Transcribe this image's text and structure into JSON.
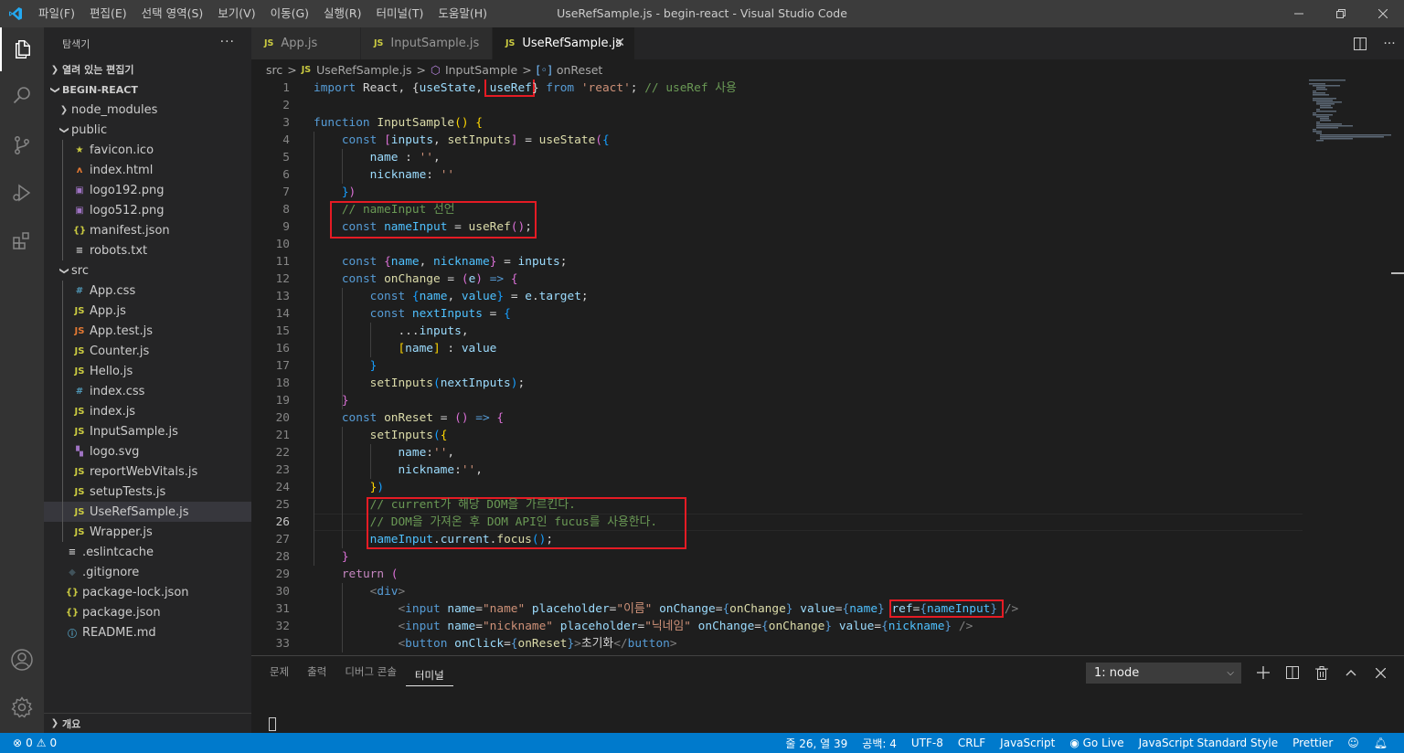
{
  "window": {
    "title": "UseRefSample.js - begin-react - Visual Studio Code",
    "menu": [
      "파일(F)",
      "편집(E)",
      "선택 영역(S)",
      "보기(V)",
      "이동(G)",
      "실행(R)",
      "터미널(T)",
      "도움말(H)"
    ]
  },
  "sidebar": {
    "title": "탐색기",
    "open_editors": "열려 있는 편집기",
    "project": "BEGIN-REACT",
    "outline": "개요",
    "tree": [
      {
        "label": "node_modules",
        "kind": "folder-closed",
        "depth": 0,
        "icon": ""
      },
      {
        "label": "public",
        "kind": "folder-open",
        "depth": 0,
        "icon": ""
      },
      {
        "label": "favicon.ico",
        "kind": "file",
        "depth": 1,
        "icon": "★",
        "color": "#cbcb41"
      },
      {
        "label": "index.html",
        "kind": "file",
        "depth": 1,
        "icon": "ʌ",
        "color": "#e37933"
      },
      {
        "label": "logo192.png",
        "kind": "file",
        "depth": 1,
        "icon": "▣",
        "color": "#a074c4"
      },
      {
        "label": "logo512.png",
        "kind": "file",
        "depth": 1,
        "icon": "▣",
        "color": "#a074c4"
      },
      {
        "label": "manifest.json",
        "kind": "file",
        "depth": 1,
        "icon": "{}",
        "color": "#cbcb41"
      },
      {
        "label": "robots.txt",
        "kind": "file",
        "depth": 1,
        "icon": "≡",
        "color": "#cccccc"
      },
      {
        "label": "src",
        "kind": "folder-open",
        "depth": 0,
        "icon": ""
      },
      {
        "label": "App.css",
        "kind": "file",
        "depth": 1,
        "icon": "#",
        "color": "#519aba"
      },
      {
        "label": "App.js",
        "kind": "file",
        "depth": 1,
        "icon": "JS",
        "color": "#cbcb41"
      },
      {
        "label": "App.test.js",
        "kind": "file",
        "depth": 1,
        "icon": "JS",
        "color": "#e37933"
      },
      {
        "label": "Counter.js",
        "kind": "file",
        "depth": 1,
        "icon": "JS",
        "color": "#cbcb41"
      },
      {
        "label": "Hello.js",
        "kind": "file",
        "depth": 1,
        "icon": "JS",
        "color": "#cbcb41"
      },
      {
        "label": "index.css",
        "kind": "file",
        "depth": 1,
        "icon": "#",
        "color": "#519aba"
      },
      {
        "label": "index.js",
        "kind": "file",
        "depth": 1,
        "icon": "JS",
        "color": "#cbcb41"
      },
      {
        "label": "InputSample.js",
        "kind": "file",
        "depth": 1,
        "icon": "JS",
        "color": "#cbcb41"
      },
      {
        "label": "logo.svg",
        "kind": "file",
        "depth": 1,
        "icon": "▚",
        "color": "#a074c4"
      },
      {
        "label": "reportWebVitals.js",
        "kind": "file",
        "depth": 1,
        "icon": "JS",
        "color": "#cbcb41"
      },
      {
        "label": "setupTests.js",
        "kind": "file",
        "depth": 1,
        "icon": "JS",
        "color": "#cbcb41"
      },
      {
        "label": "UseRefSample.js",
        "kind": "file",
        "depth": 1,
        "icon": "JS",
        "color": "#cbcb41",
        "selected": true
      },
      {
        "label": "Wrapper.js",
        "kind": "file",
        "depth": 1,
        "icon": "JS",
        "color": "#cbcb41"
      },
      {
        "label": ".eslintcache",
        "kind": "file",
        "depth": 0,
        "icon": "≡",
        "color": "#cccccc"
      },
      {
        "label": ".gitignore",
        "kind": "file",
        "depth": 0,
        "icon": "◆",
        "color": "#41535b"
      },
      {
        "label": "package-lock.json",
        "kind": "file",
        "depth": 0,
        "icon": "{}",
        "color": "#cbcb41"
      },
      {
        "label": "package.json",
        "kind": "file",
        "depth": 0,
        "icon": "{}",
        "color": "#cbcb41"
      },
      {
        "label": "README.md",
        "kind": "file",
        "depth": 0,
        "icon": "ⓘ",
        "color": "#519aba"
      }
    ]
  },
  "tabs": [
    {
      "label": "App.js",
      "active": false
    },
    {
      "label": "InputSample.js",
      "active": false
    },
    {
      "label": "UseRefSample.js",
      "active": true
    }
  ],
  "breadcrumb": {
    "folder": "src",
    "file": "UseRefSample.js",
    "function": "InputSample",
    "member": "onReset"
  },
  "editor": {
    "current_line": 26,
    "lines": [
      [
        [
          "kw",
          "import"
        ],
        [
          "t",
          " React, {"
        ],
        [
          "var",
          "useState"
        ],
        [
          "t",
          ", "
        ],
        [
          "var",
          "useRef"
        ],
        [
          "t",
          "} "
        ],
        [
          "kw",
          "from"
        ],
        [
          "t",
          " "
        ],
        [
          "str",
          "'react'"
        ],
        [
          "t",
          "; "
        ],
        [
          "cmt",
          "// useRef 사용"
        ]
      ],
      [],
      [
        [
          "kw",
          "function"
        ],
        [
          "t",
          " "
        ],
        [
          "fnc",
          "InputSample"
        ],
        [
          "p1",
          "()"
        ],
        [
          "t",
          " "
        ],
        [
          "p1",
          "{"
        ]
      ],
      [
        [
          "t",
          "    "
        ],
        [
          "kw",
          "const"
        ],
        [
          "t",
          " "
        ],
        [
          "p2",
          "["
        ],
        [
          "var",
          "inputs"
        ],
        [
          "t",
          ", "
        ],
        [
          "fnc",
          "setInputs"
        ],
        [
          "p2",
          "]"
        ],
        [
          "t",
          " = "
        ],
        [
          "fnc",
          "useState"
        ],
        [
          "p2",
          "("
        ],
        [
          "p3",
          "{"
        ]
      ],
      [
        [
          "t",
          "        "
        ],
        [
          "var",
          "name"
        ],
        [
          "t",
          " : "
        ],
        [
          "str",
          "''"
        ],
        [
          "t",
          ","
        ]
      ],
      [
        [
          "t",
          "        "
        ],
        [
          "var",
          "nickname"
        ],
        [
          "t",
          ": "
        ],
        [
          "str",
          "''"
        ]
      ],
      [
        [
          "t",
          "    "
        ],
        [
          "p3",
          "}"
        ],
        [
          "p2",
          ")"
        ]
      ],
      [
        [
          "t",
          "    "
        ],
        [
          "cmt",
          "// nameInput 선언"
        ]
      ],
      [
        [
          "t",
          "    "
        ],
        [
          "kw",
          "const"
        ],
        [
          "t",
          " "
        ],
        [
          "cst",
          "nameInput"
        ],
        [
          "t",
          " = "
        ],
        [
          "fnc",
          "useRef"
        ],
        [
          "p2",
          "()"
        ],
        [
          "t",
          ";"
        ]
      ],
      [],
      [
        [
          "t",
          "    "
        ],
        [
          "kw",
          "const"
        ],
        [
          "t",
          " "
        ],
        [
          "p2",
          "{"
        ],
        [
          "cst",
          "name"
        ],
        [
          "t",
          ", "
        ],
        [
          "cst",
          "nickname"
        ],
        [
          "p2",
          "}"
        ],
        [
          "t",
          " = "
        ],
        [
          "var",
          "inputs"
        ],
        [
          "t",
          ";"
        ]
      ],
      [
        [
          "t",
          "    "
        ],
        [
          "kw",
          "const"
        ],
        [
          "t",
          " "
        ],
        [
          "fnc",
          "onChange"
        ],
        [
          "t",
          " = "
        ],
        [
          "p2",
          "("
        ],
        [
          "var",
          "e"
        ],
        [
          "p2",
          ")"
        ],
        [
          "t",
          " "
        ],
        [
          "kw",
          "=>"
        ],
        [
          "t",
          " "
        ],
        [
          "p2",
          "{"
        ]
      ],
      [
        [
          "t",
          "        "
        ],
        [
          "kw",
          "const"
        ],
        [
          "t",
          " "
        ],
        [
          "p3",
          "{"
        ],
        [
          "cst",
          "name"
        ],
        [
          "t",
          ", "
        ],
        [
          "cst",
          "value"
        ],
        [
          "p3",
          "}"
        ],
        [
          "t",
          " = "
        ],
        [
          "var",
          "e"
        ],
        [
          "t",
          "."
        ],
        [
          "var",
          "target"
        ],
        [
          "t",
          ";"
        ]
      ],
      [
        [
          "t",
          "        "
        ],
        [
          "kw",
          "const"
        ],
        [
          "t",
          " "
        ],
        [
          "cst",
          "nextInputs"
        ],
        [
          "t",
          " = "
        ],
        [
          "p3",
          "{"
        ]
      ],
      [
        [
          "t",
          "            ..."
        ],
        [
          "var",
          "inputs"
        ],
        [
          "t",
          ","
        ]
      ],
      [
        [
          "t",
          "            "
        ],
        [
          "p1",
          "["
        ],
        [
          "var",
          "name"
        ],
        [
          "p1",
          "]"
        ],
        [
          "t",
          " : "
        ],
        [
          "var",
          "value"
        ]
      ],
      [
        [
          "t",
          "        "
        ],
        [
          "p3",
          "}"
        ]
      ],
      [
        [
          "t",
          "        "
        ],
        [
          "fnc",
          "setInputs"
        ],
        [
          "p3",
          "("
        ],
        [
          "var",
          "nextInputs"
        ],
        [
          "p3",
          ")"
        ],
        [
          "t",
          ";"
        ]
      ],
      [
        [
          "t",
          "    "
        ],
        [
          "p2",
          "}"
        ]
      ],
      [
        [
          "t",
          "    "
        ],
        [
          "kw",
          "const"
        ],
        [
          "t",
          " "
        ],
        [
          "fnc",
          "onReset"
        ],
        [
          "t",
          " = "
        ],
        [
          "p2",
          "()"
        ],
        [
          "t",
          " "
        ],
        [
          "kw",
          "=>"
        ],
        [
          "t",
          " "
        ],
        [
          "p2",
          "{"
        ]
      ],
      [
        [
          "t",
          "        "
        ],
        [
          "fnc",
          "setInputs"
        ],
        [
          "p3",
          "("
        ],
        [
          "p1",
          "{"
        ]
      ],
      [
        [
          "t",
          "            "
        ],
        [
          "var",
          "name"
        ],
        [
          "t",
          ":"
        ],
        [
          "str",
          "''"
        ],
        [
          "t",
          ","
        ]
      ],
      [
        [
          "t",
          "            "
        ],
        [
          "var",
          "nickname"
        ],
        [
          "t",
          ":"
        ],
        [
          "str",
          "''"
        ],
        [
          "t",
          ","
        ]
      ],
      [
        [
          "t",
          "        "
        ],
        [
          "p1",
          "}"
        ],
        [
          "p3",
          ")"
        ]
      ],
      [
        [
          "t",
          "        "
        ],
        [
          "cmt",
          "// current가 해당 DOM을 가르킨다."
        ]
      ],
      [
        [
          "t",
          "        "
        ],
        [
          "cmt",
          "// DOM을 가져온 후 DOM API인 fucus를 사용한다."
        ]
      ],
      [
        [
          "t",
          "        "
        ],
        [
          "cst",
          "nameInput"
        ],
        [
          "t",
          "."
        ],
        [
          "var",
          "current"
        ],
        [
          "t",
          "."
        ],
        [
          "fnc",
          "focus"
        ],
        [
          "p3",
          "()"
        ],
        [
          "t",
          ";"
        ]
      ],
      [
        [
          "t",
          "    "
        ],
        [
          "p2",
          "}"
        ]
      ],
      [
        [
          "t",
          "    "
        ],
        [
          "ctl",
          "return"
        ],
        [
          "t",
          " "
        ],
        [
          "p2",
          "("
        ]
      ],
      [
        [
          "t",
          "        "
        ],
        [
          "brk",
          "<"
        ],
        [
          "tag",
          "div"
        ],
        [
          "brk",
          ">"
        ]
      ],
      [
        [
          "t",
          "            "
        ],
        [
          "brk",
          "<"
        ],
        [
          "tag",
          "input"
        ],
        [
          "t",
          " "
        ],
        [
          "attr",
          "name"
        ],
        [
          "t",
          "="
        ],
        [
          "str",
          "\"name\""
        ],
        [
          "t",
          " "
        ],
        [
          "attr",
          "placeholder"
        ],
        [
          "t",
          "="
        ],
        [
          "str",
          "\"이름\""
        ],
        [
          "t",
          " "
        ],
        [
          "attr",
          "onChange"
        ],
        [
          "t",
          "="
        ],
        [
          "kw",
          "{"
        ],
        [
          "fnc",
          "onChange"
        ],
        [
          "kw",
          "}"
        ],
        [
          "t",
          " "
        ],
        [
          "attr",
          "value"
        ],
        [
          "t",
          "="
        ],
        [
          "kw",
          "{"
        ],
        [
          "cst",
          "name"
        ],
        [
          "kw",
          "}"
        ],
        [
          "t",
          " "
        ],
        [
          "attr",
          "ref"
        ],
        [
          "t",
          "="
        ],
        [
          "kw",
          "{"
        ],
        [
          "cst",
          "nameInput"
        ],
        [
          "kw",
          "}"
        ],
        [
          "t",
          " "
        ],
        [
          "brk",
          "/>"
        ]
      ],
      [
        [
          "t",
          "            "
        ],
        [
          "brk",
          "<"
        ],
        [
          "tag",
          "input"
        ],
        [
          "t",
          " "
        ],
        [
          "attr",
          "name"
        ],
        [
          "t",
          "="
        ],
        [
          "str",
          "\"nickname\""
        ],
        [
          "t",
          " "
        ],
        [
          "attr",
          "placeholder"
        ],
        [
          "t",
          "="
        ],
        [
          "str",
          "\"닉네임\""
        ],
        [
          "t",
          " "
        ],
        [
          "attr",
          "onChange"
        ],
        [
          "t",
          "="
        ],
        [
          "kw",
          "{"
        ],
        [
          "fnc",
          "onChange"
        ],
        [
          "kw",
          "}"
        ],
        [
          "t",
          " "
        ],
        [
          "attr",
          "value"
        ],
        [
          "t",
          "="
        ],
        [
          "kw",
          "{"
        ],
        [
          "cst",
          "nickname"
        ],
        [
          "kw",
          "}"
        ],
        [
          "t",
          " "
        ],
        [
          "brk",
          "/>"
        ]
      ],
      [
        [
          "t",
          "            "
        ],
        [
          "brk",
          "<"
        ],
        [
          "tag",
          "button"
        ],
        [
          "t",
          " "
        ],
        [
          "attr",
          "onClick"
        ],
        [
          "t",
          "="
        ],
        [
          "kw",
          "{"
        ],
        [
          "fnc",
          "onReset"
        ],
        [
          "kw",
          "}"
        ],
        [
          "brk",
          ">"
        ],
        [
          "t",
          "초기화"
        ],
        [
          "brk",
          "</"
        ],
        [
          "tag",
          "button"
        ],
        [
          "brk",
          ">"
        ]
      ]
    ]
  },
  "panel": {
    "tabs": [
      "문제",
      "출력",
      "디버그 콘솔",
      "터미널"
    ],
    "active_tab": "터미널",
    "terminal_select": "1: node"
  },
  "statusbar": {
    "errors": "0",
    "warnings": "0",
    "items": [
      "줄 26, 열 39",
      "공백: 4",
      "UTF-8",
      "CRLF",
      "JavaScript",
      "Go Live",
      "JavaScript Standard Style",
      "Prettier"
    ]
  },
  "colors": {
    "accent": "#007acc",
    "highlight_box": "#e51b24",
    "js_icon": "#cbcb41"
  }
}
